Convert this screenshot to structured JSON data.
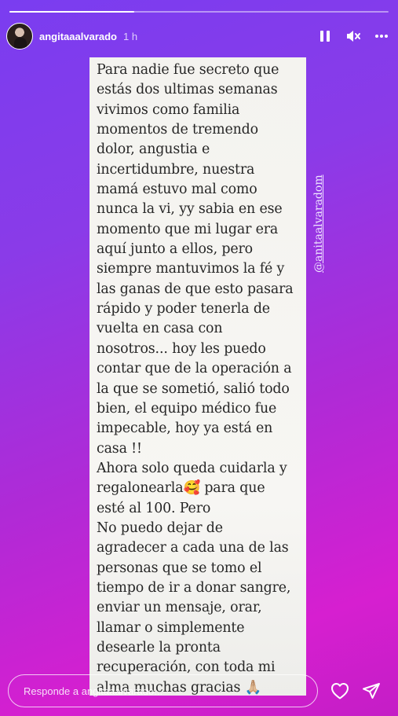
{
  "story": {
    "progress_fraction": 0.33,
    "username": "angitaaalvarado",
    "time": "1 h",
    "text_lines": [
      "Para nadie fue secreto que",
      "estás dos ultimas semanas",
      "vivimos como familia",
      "momentos de tremendo",
      "dolor, angustia e",
      "incertidumbre, nuestra",
      "mamá estuvo mal como",
      "nunca la vi, yy sabia en ese",
      "momento que mi lugar era",
      "aquí junto a ellos, pero",
      "siempre mantuvimos la fé y",
      "las ganas de que esto pasara",
      "rápido y poder tenerla de",
      "vuelta en casa con",
      "nosotros... hoy les puedo",
      "contar que de la operación a",
      "la que se sometió, salió todo",
      "bien, el equipo médico fue",
      "impecable, hoy ya está en",
      "casa !!",
      "Ahora solo queda cuidarla y",
      "regalonearla🥰 para que",
      "esté al 100. Pero",
      "No puedo dejar de",
      "agradecer a cada una de las",
      "personas que se tomo el",
      "tiempo de ir a donar sangre,",
      "enviar un mensaje, orar,",
      "llamar o simplemente",
      "desearle la pronta",
      "recuperación, con toda mi",
      "alma muchas gracias 🙏🏼"
    ],
    "mention": "@anitaalvaradom"
  },
  "icons": {
    "pause": "pause-icon",
    "mute": "muted-speaker-icon",
    "more": "more-horizontal-icon",
    "heart": "heart-icon",
    "share": "send-icon"
  },
  "footer": {
    "reply_placeholder": "Responde a angitaaalvarado..."
  }
}
